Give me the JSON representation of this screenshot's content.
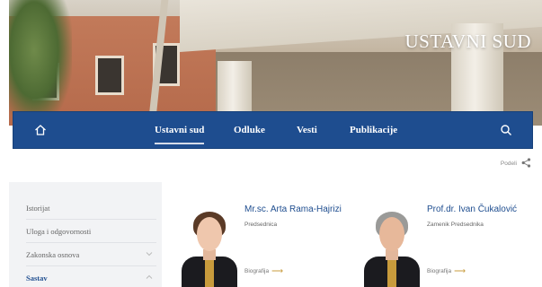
{
  "site": {
    "title": "USTAVNI SUD"
  },
  "nav": {
    "home_icon": "home-icon",
    "items": [
      {
        "label": "Ustavni sud",
        "active": true
      },
      {
        "label": "Odluke",
        "active": false
      },
      {
        "label": "Vesti",
        "active": false
      },
      {
        "label": "Publikacije",
        "active": false
      }
    ],
    "search_icon": "search-icon"
  },
  "share": {
    "label": "Podeli",
    "icon": "share-icon"
  },
  "sidebar": {
    "items": [
      {
        "label": "Istorijat",
        "expandable": false,
        "active": false
      },
      {
        "label": "Uloga i odgovornosti",
        "expandable": false,
        "active": false
      },
      {
        "label": "Zakonska osnova",
        "expandable": true,
        "expanded": false,
        "active": false
      },
      {
        "label": "Sastav",
        "expandable": true,
        "expanded": true,
        "active": true
      }
    ]
  },
  "judges": [
    {
      "name": "Mr.sc. Arta Rama-Hajrizi",
      "role": "Predsednica",
      "bio_label": "Biografija"
    },
    {
      "name": "Prof.dr. Ivan Čukalović",
      "role": "Zamenik Predsednika",
      "bio_label": "Biografija"
    }
  ],
  "colors": {
    "nav_blue": "#1e4d8f",
    "accent_gold": "#c89b3c",
    "sidebar_bg": "#f2f3f5"
  }
}
